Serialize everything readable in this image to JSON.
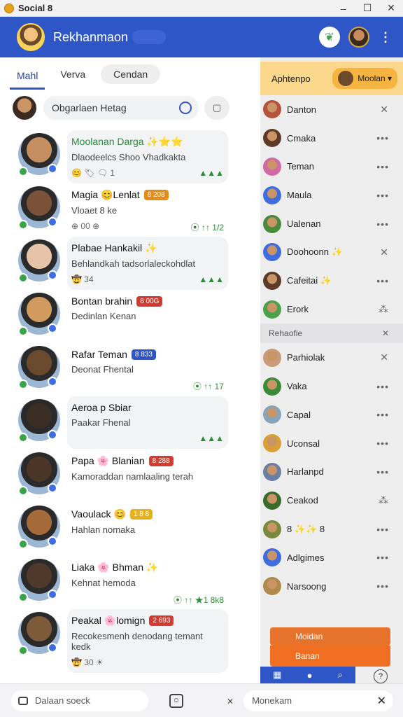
{
  "window": {
    "title": "Social 8",
    "controls": [
      "–",
      "☐",
      "✕"
    ]
  },
  "header": {
    "user_name": "Rekhanmaon"
  },
  "tabs": [
    {
      "label": "Mahl",
      "active": true
    },
    {
      "label": "Verva",
      "active": false
    },
    {
      "label": "Cendan",
      "active": false
    }
  ],
  "search": {
    "placeholder": "Obgarlaen Hetag"
  },
  "posts": [
    {
      "name": "Moolanan Darga ✨⭐⭐",
      "tag": "",
      "text": "Dlaodeelcs Shoo Vhadkakta",
      "meta": "😊 🏷\n🗨 1",
      "react": "▲▲▲",
      "color": "#3aa34a",
      "filled": true
    },
    {
      "name": "Magia 😊Lenlat",
      "tag": "8 208",
      "tag_color": "#e48b1a",
      "text": "Vloaet 8 ke",
      "meta": "⊕ 00 ⊕",
      "react": "⦿ ↑↑ 1/2",
      "filled": false
    },
    {
      "name": "Plabae Hankakil ✨",
      "tag": "",
      "text": "Behlandkah tadsorlaleckohdlat",
      "meta": "🤠 34",
      "react": "▲▲▲",
      "filled": true
    },
    {
      "name": "Bontan brahin",
      "tag": "8 00G",
      "tag_color": "#d23b2f",
      "text": "Dedinlan Kenan",
      "meta": "",
      "react": "",
      "filled": false
    },
    {
      "name": "Rafar Teman",
      "tag": "8 833",
      "tag_color": "#2f56c6",
      "text": "Deonat Fhental",
      "meta": "",
      "react": "⦿ ↑↑ 17",
      "filled": false
    },
    {
      "name": "Aeroa p Sbiar",
      "tag": "",
      "text": "Paakar Fhenal",
      "meta": "",
      "react": "▲▲▲",
      "filled": true
    },
    {
      "name": "Papa 🌸 Blanian",
      "tag": "8 288",
      "tag_color": "#d23b2f",
      "text": "Kamoraddan namlaaling terah",
      "meta": "",
      "react": "",
      "filled": false
    },
    {
      "name": "Vaoulack 😊",
      "tag": "1 8 8",
      "tag_color": "#e8b21a",
      "text": "Hahlan nomaka",
      "meta": "",
      "react": "",
      "filled": false
    },
    {
      "name": "Liaka 🌸 Bhman ✨",
      "tag": "",
      "text": "Kehnat hemoda",
      "meta": "",
      "react": "⦿ ↑↑ ★1 8k8",
      "filled": false
    },
    {
      "name": "Peakal 🌸lomign",
      "tag": "2 693",
      "tag_color": "#d23b2f",
      "text": "Recokesmenh denodang temant kedk",
      "meta": "🤠 30 ☀",
      "react": "",
      "filled": true
    }
  ],
  "right": {
    "header_label": "Aphtenpo",
    "dropdown": "Moolan",
    "contacts_top": [
      {
        "name": "Danton",
        "action": "✕"
      },
      {
        "name": "Cmaka",
        "action": "•••"
      },
      {
        "name": "Teman",
        "action": "•••"
      },
      {
        "name": "Maula",
        "action": "•••"
      },
      {
        "name": "Ualenan",
        "action": "•••"
      },
      {
        "name": "Doohoonn ✨",
        "action": "✕"
      },
      {
        "name": "Cafeitai ✨",
        "action": "•••"
      },
      {
        "name": "Erork",
        "action": "⁂"
      }
    ],
    "section_label": "Rehaofie",
    "section_action": "✕",
    "contacts_bottom": [
      {
        "name": "Parhiolak",
        "action": "✕"
      },
      {
        "name": "Vaka",
        "action": "•••"
      },
      {
        "name": "Capal",
        "action": "•••"
      },
      {
        "name": "Uconsal",
        "action": "•••"
      },
      {
        "name": "Harlanpd",
        "action": "•••"
      },
      {
        "name": "Ceakod",
        "action": "⁂"
      },
      {
        "name": "8 ✨✨ 8",
        "action": "•••"
      },
      {
        "name": "Adlgimes",
        "action": "•••"
      },
      {
        "name": "Narsoong",
        "action": "•••"
      }
    ],
    "bar_orange_label": "Moidan",
    "bar_blue_label": "Banan"
  },
  "bottom": {
    "search_placeholder": "Dalaan soeck",
    "message_placeholder": "Monekam"
  }
}
